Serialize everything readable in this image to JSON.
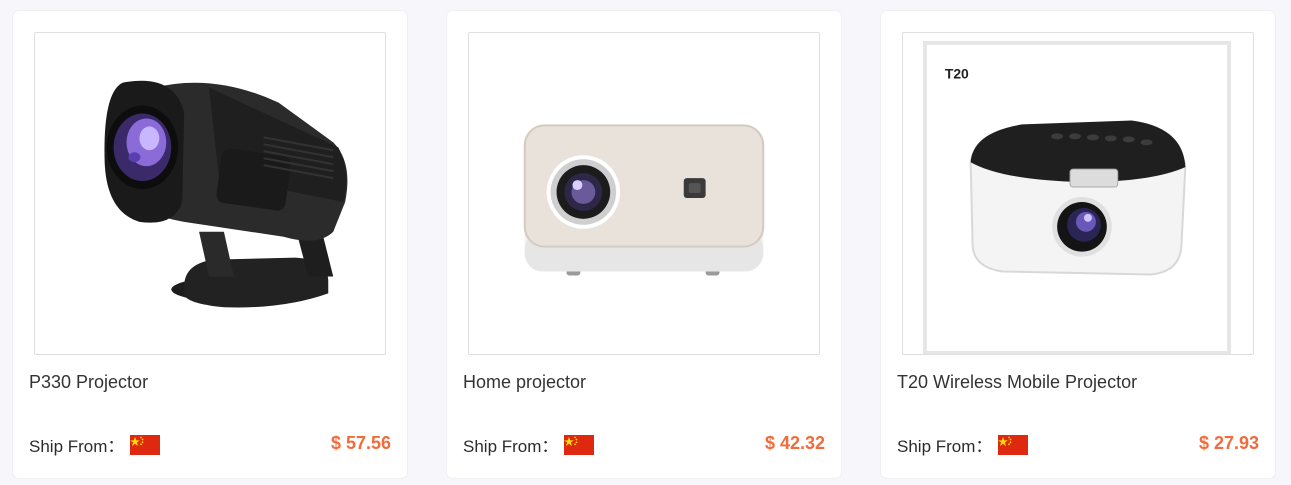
{
  "colors": {
    "price": "#f26b3a",
    "flag_red": "#de2910",
    "flag_star": "#ffde00"
  },
  "ship_from_label": "Ship From：",
  "products": [
    {
      "title": "P330 Projector",
      "price": "$ 57.56",
      "origin_flag": "china-flag-icon"
    },
    {
      "title": "Home projector",
      "price": "$ 42.32",
      "origin_flag": "china-flag-icon"
    },
    {
      "title": "T20 Wireless Mobile Projector",
      "price": "$ 27.93",
      "origin_flag": "china-flag-icon",
      "image_text": "T20"
    }
  ]
}
